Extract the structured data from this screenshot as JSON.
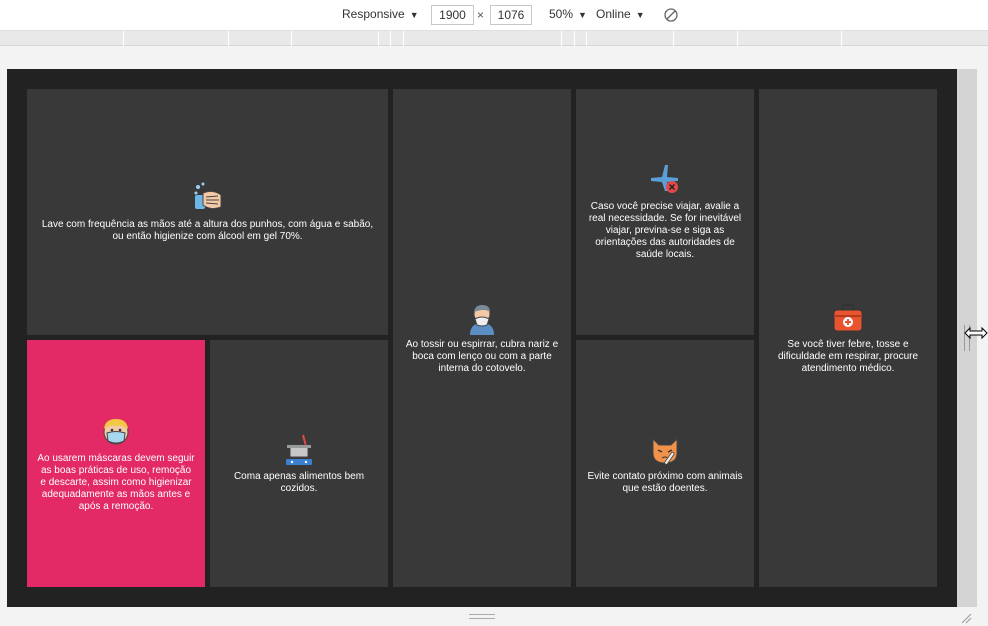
{
  "toolbar": {
    "device": "Responsive",
    "width": "1900",
    "times": "×",
    "height": "1076",
    "zoom": "50%",
    "throttle": "Online"
  },
  "cards": [
    {
      "icon": "hand-washing-icon",
      "text": "Lave com frequência as mãos até a altura dos punhos, com água e sabão, ou então higienize com álcool em gel 70%."
    },
    {
      "icon": "person-sneezing-icon",
      "text": "Ao tossir ou espirrar, cubra nariz e boca com lenço ou com a parte interna do cotovelo."
    },
    {
      "icon": "airplane-cancel-icon",
      "text": "Caso você precise viajar, avalie a real necessidade. Se for inevitável viajar, previna-se e siga as orientações das autoridades de saúde locais."
    },
    {
      "icon": "first-aid-kit-icon",
      "text": "Se você tiver febre, tosse e dificuldade em respirar, procure atendimento médico."
    },
    {
      "icon": "face-mask-icon",
      "text": "Ao usarem máscaras devem seguir as boas práticas de uso, remoção e descarte, assim como higienizar adequadamente as mãos antes e após a remoção."
    },
    {
      "icon": "cooking-pot-icon",
      "text": "Coma apenas alimentos bem cozidos."
    },
    {
      "icon": "sick-cat-icon",
      "text": "Evite contato próximo com animais que estão doentes."
    }
  ],
  "colors": {
    "viewport_bg": "#222222",
    "card_bg": "#393939",
    "accent_card_bg": "#e32a67"
  }
}
